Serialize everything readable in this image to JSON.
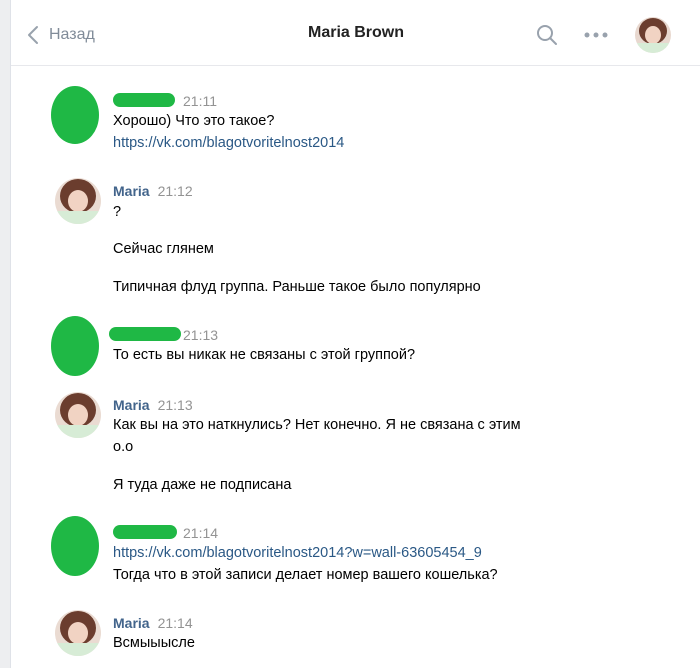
{
  "header": {
    "back_label": "Назад",
    "title": "Maria Brown"
  },
  "messages": [
    {
      "author": "",
      "time": "21:11",
      "lines": [
        {
          "text": "Хорошо) Что это такое?",
          "type": "text"
        },
        {
          "text": "https://vk.com/blagotvoritelnost2014",
          "type": "link"
        }
      ]
    },
    {
      "author": "Maria",
      "time": "21:12",
      "lines": [
        {
          "text": "?",
          "type": "text"
        },
        {
          "text": "Сейчас глянем",
          "type": "text"
        },
        {
          "text": "Типичная флуд группа. Раньше такое было популярно",
          "type": "text"
        }
      ]
    },
    {
      "author": "",
      "time": "21:13",
      "lines": [
        {
          "text": "То есть вы никак не связаны с этой группой?",
          "type": "text"
        }
      ]
    },
    {
      "author": "Maria",
      "time": "21:13",
      "lines": [
        {
          "text": "Как вы на это наткнулись? Нет конечно. Я не связана с этим",
          "type": "text"
        },
        {
          "text": "о.о",
          "type": "text"
        },
        {
          "text": "Я туда даже не подписана",
          "type": "text"
        }
      ]
    },
    {
      "author": "",
      "time": "21:14",
      "lines": [
        {
          "text": "https://vk.com/blagotvoritelnost2014?w=wall-63605454_9",
          "type": "link"
        },
        {
          "text": "Тогда что в этой записи делает номер вашего кошелька?",
          "type": "text"
        }
      ]
    },
    {
      "author": "Maria",
      "time": "21:14",
      "lines": [
        {
          "text": "Всмыыысле",
          "type": "text"
        }
      ]
    }
  ],
  "colors": {
    "accent": "#2a5885",
    "author": "#42648b",
    "redaction": "#1fb845",
    "muted": "#939393"
  }
}
